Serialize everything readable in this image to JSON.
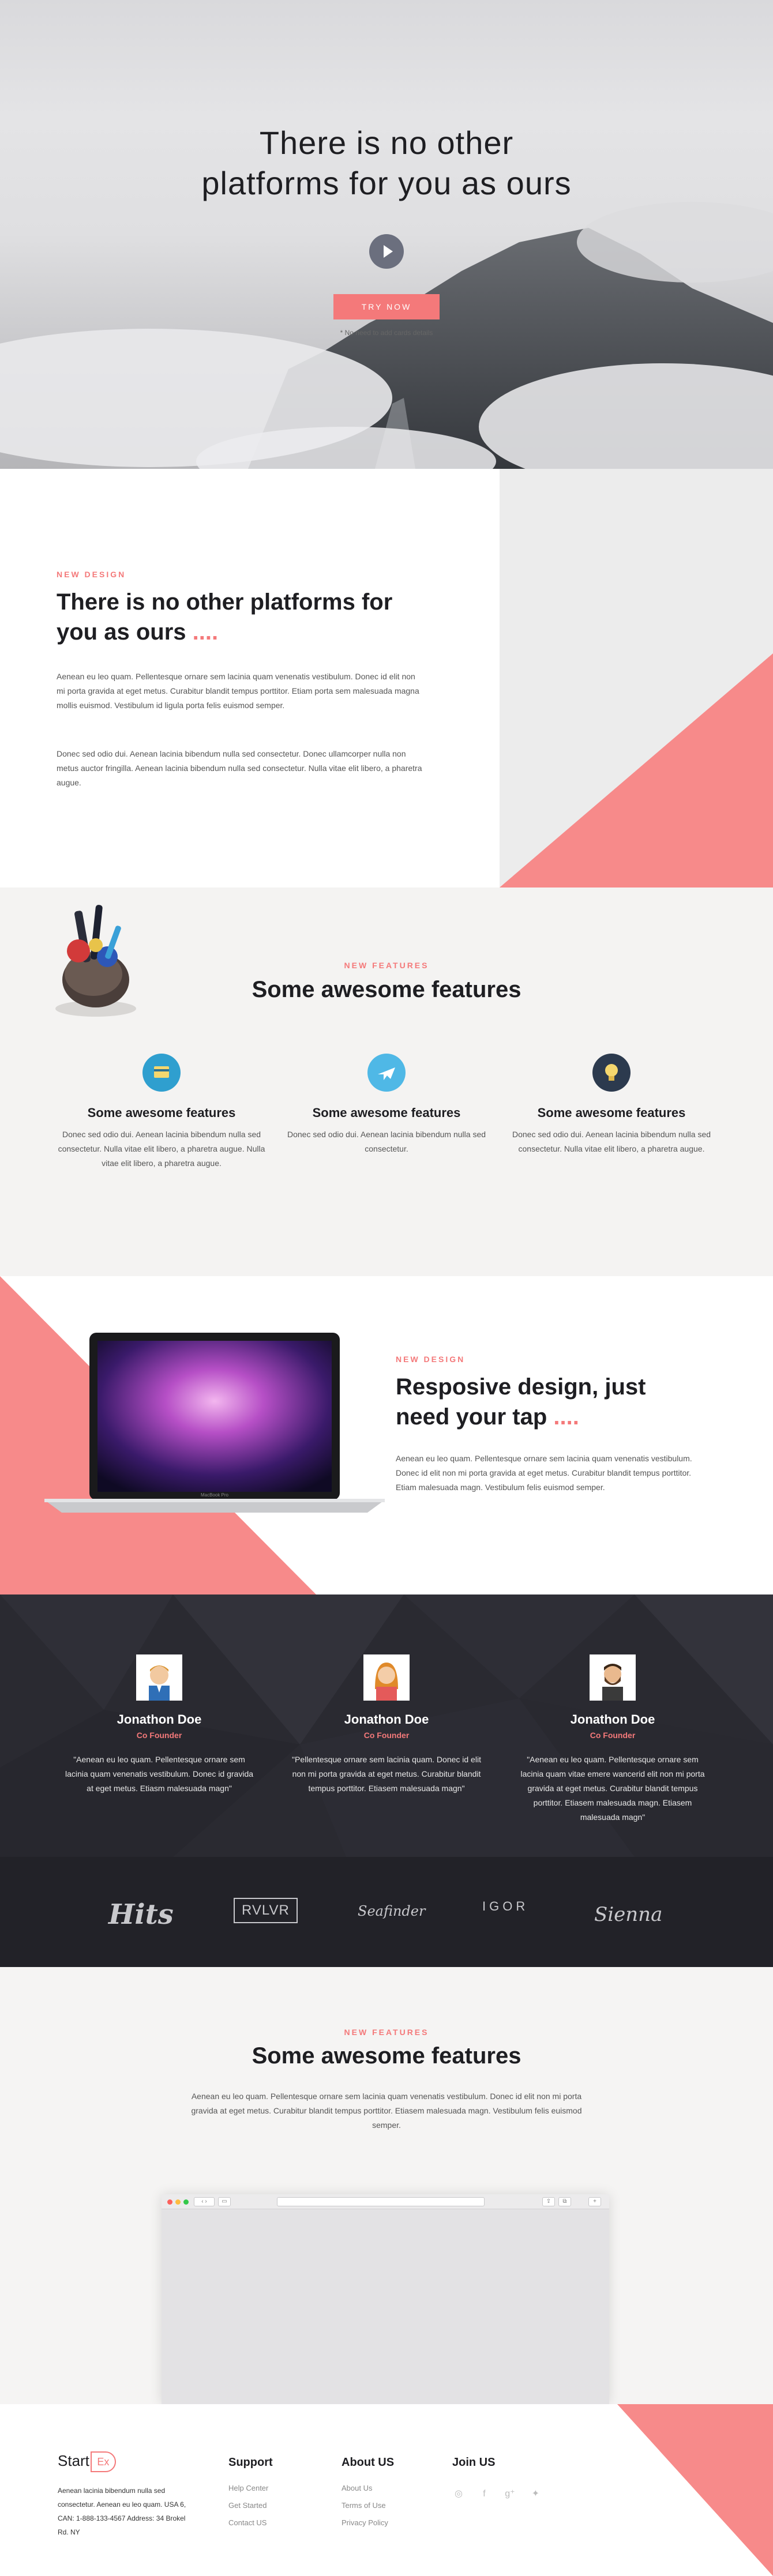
{
  "hero": {
    "title_line1": "There is no other",
    "title_line2": "platforms for you as ours",
    "cta": "TRY NOW",
    "note": "* No need to add cards details",
    "play_icon": "play-icon"
  },
  "intro": {
    "eyebrow": "NEW DESIGN",
    "title": "There is no other platforms for you as ours",
    "title_dots": "....",
    "p1": "Aenean eu leo quam. Pellentesque ornare sem lacinia quam venenatis vestibulum. Donec id elit non mi porta gravida at eget metus. Curabitur blandit tempus porttitor. Etiam porta sem malesuada magna mollis euismod. Vestibulum id ligula porta felis euismod semper.",
    "p2": "Donec sed odio dui. Aenean lacinia bibendum nulla sed consectetur. Donec ullamcorper nulla non metus auctor fringilla. Aenean lacinia bibendum nulla sed consectetur. Nulla vitae elit libero, a pharetra augue."
  },
  "features": {
    "eyebrow": "NEW FEATURES",
    "title": "Some awesome features",
    "items": [
      {
        "title": "Some awesome features",
        "text": "Donec sed odio dui. Aenean lacinia bibendum nulla sed consectetur. Nulla vitae elit libero, a pharetra augue. Nulla vitae elit libero, a pharetra augue.",
        "icon": "card-icon",
        "color": "#2f9fcf"
      },
      {
        "title": "Some awesome features",
        "text": "Donec sed odio dui. Aenean lacinia bibendum nulla sed consectetur.",
        "icon": "plane-icon",
        "color": "#4fb8e6"
      },
      {
        "title": "Some awesome features",
        "text": "Donec sed odio dui. Aenean lacinia bibendum nulla sed consectetur. Nulla vitae elit libero, a pharetra augue.",
        "icon": "lightbulb-icon",
        "color": "#2c3a4e"
      }
    ]
  },
  "responsive": {
    "eyebrow": "NEW DESIGN",
    "title": "Resposive design, just need your tap",
    "title_dots": "....",
    "text": "Aenean eu leo quam. Pellentesque ornare sem lacinia quam venenatis vestibulum. Donec id elit non mi porta gravida at eget metus. Curabitur blandit tempus porttitor. Etiam malesuada magn. Vestibulum felis euismod semper.",
    "laptop_caption": "MacBook Pro"
  },
  "testimonials": [
    {
      "name": "Jonathon Doe",
      "role": "Co Founder",
      "quote": "\"Aenean eu leo quam. Pellentesque ornare sem lacinia quam venenatis vestibulum. Donec id gravida at eget metus. Etiasm malesuada magn\""
    },
    {
      "name": "Jonathon Doe",
      "role": "Co Founder",
      "quote": "\"Pellentesque ornare sem lacinia quam. Donec id elit non mi porta gravida at eget metus. Curabitur blandit tempus porttitor. Etiasem malesuada magn\""
    },
    {
      "name": "Jonathon Doe",
      "role": "Co Founder",
      "quote": "\"Aenean eu leo quam. Pellentesque ornare sem lacinia quam vitae emere wancerid elit non mi porta gravida at eget metus. Curabitur blandit tempus porttitor. Etiasem malesuada magn. Etiasem malesuada magn\""
    }
  ],
  "logos": [
    "Hits",
    "RVLVR",
    "Seafinder",
    "IGOR",
    "Sienna"
  ],
  "features2": {
    "eyebrow": "NEW FEATURES",
    "title": "Some awesome features",
    "text": "Aenean eu leo quam. Pellentesque ornare sem lacinia quam venenatis vestibulum. Donec id elit non mi porta gravida at eget metus. Curabitur blandit tempus porttitor. Etiasem malesuada magn. Vestibulum felis euismod semper."
  },
  "footer": {
    "brand": "Start",
    "brand_badge": "Ex",
    "address": "Aenean lacinia bibendum nulla sed consectetur. Aenean eu leo quam. USA 6, CAN: 1-888-133-4567 Address: 34 Brokel Rd. NY",
    "columns": [
      {
        "title": "Support",
        "links": [
          "Help Center",
          "Get Started",
          "Contact US"
        ]
      },
      {
        "title": "About US",
        "links": [
          "About Us",
          "Terms of Use",
          "Privacy Policy"
        ]
      },
      {
        "title": "Join US",
        "links": []
      }
    ],
    "social": [
      "dribbble-icon",
      "facebook-icon",
      "google-plus-icon",
      "twitter-icon"
    ]
  },
  "colors": {
    "accent": "#f4797a",
    "dark": "#2a2a31",
    "light": "#f4f3f2"
  }
}
